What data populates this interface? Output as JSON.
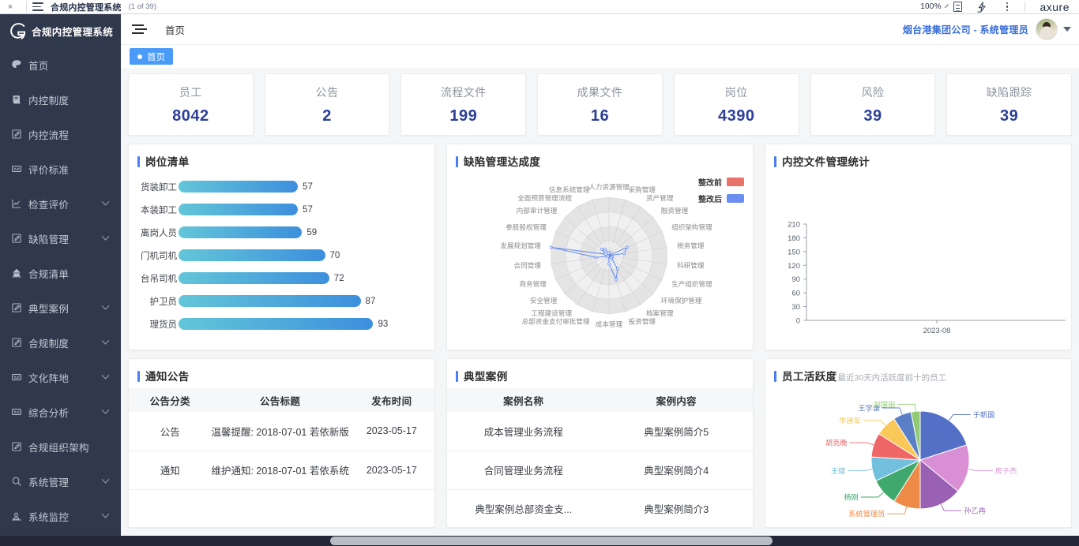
{
  "axure_bar": {
    "close_label": "×",
    "hamburger_icon": "hamburger-icon",
    "title": "合规内控管理系统",
    "page_count": "(1 of 39)",
    "zoom": "100%",
    "notes_icon": "notes-panel-icon",
    "interactions_icon": "interactions-icon",
    "overflow_icon": "more-options-icon",
    "brand": "axure"
  },
  "sidebar": {
    "logo_label": "合规内控管理系统",
    "items": [
      {
        "label": "首页",
        "icon": "palette-icon",
        "expandable": false
      },
      {
        "label": "内控制度",
        "icon": "book-icon",
        "expandable": false
      },
      {
        "label": "内控流程",
        "icon": "edit-square-icon",
        "expandable": false
      },
      {
        "label": "评价标准",
        "icon": "id-card-icon",
        "expandable": false
      },
      {
        "label": "检查评价",
        "icon": "chart-line-icon",
        "expandable": true
      },
      {
        "label": "缺陷管理",
        "icon": "edit-square-icon",
        "expandable": true
      },
      {
        "label": "合规清单",
        "icon": "archive-icon",
        "expandable": false
      },
      {
        "label": "典型案例",
        "icon": "edit-square-icon",
        "expandable": true
      },
      {
        "label": "合规制度",
        "icon": "edit-square-icon",
        "expandable": true
      },
      {
        "label": "文化阵地",
        "icon": "id-card-icon",
        "expandable": true
      },
      {
        "label": "综合分析",
        "icon": "id-card-icon",
        "expandable": true
      },
      {
        "label": "合规组织架构",
        "icon": "edit-square-icon",
        "expandable": false
      },
      {
        "label": "系统管理",
        "icon": "search-icon",
        "expandable": true
      },
      {
        "label": "系统监控",
        "icon": "monitor-user-icon",
        "expandable": true
      }
    ]
  },
  "topbar": {
    "collapse_icon": "collapse-menu-icon",
    "breadcrumb": "首页",
    "user_name": "烟台港集团公司 - 系统管理员",
    "avatar": "user-avatar",
    "caret_icon": "chevron-down-icon"
  },
  "tabbar": {
    "tabs": [
      {
        "label": "首页",
        "active": true
      }
    ]
  },
  "stats": [
    {
      "label": "员工",
      "value": "8042"
    },
    {
      "label": "公告",
      "value": "2"
    },
    {
      "label": "流程文件",
      "value": "199"
    },
    {
      "label": "成果文件",
      "value": "16"
    },
    {
      "label": "岗位",
      "value": "4390"
    },
    {
      "label": "风险",
      "value": "39"
    },
    {
      "label": "缺陷跟踪",
      "value": "39"
    }
  ],
  "panels": {
    "positions": {
      "title": "岗位清单"
    },
    "defects": {
      "title": "缺陷管理达成度"
    },
    "docstats": {
      "title": "内控文件管理统计"
    },
    "notices": {
      "title": "通知公告"
    },
    "cases": {
      "title": "典型案例"
    },
    "activity": {
      "title": "员工活跃度",
      "subtitle": "最近30天内活跃度前十的员工"
    }
  },
  "notices_table": {
    "columns": [
      "公告分类",
      "公告标题",
      "发布时间"
    ],
    "rows": [
      [
        "公告",
        "温馨提醒: 2018-07-01 若依新版...",
        "2023-05-17"
      ],
      [
        "通知",
        "维护通知: 2018-07-01 若依系统...",
        "2023-05-17"
      ]
    ]
  },
  "cases_table": {
    "columns": [
      "案例名称",
      "案例内容"
    ],
    "rows": [
      [
        "成本管理业务流程",
        "典型案例简介5"
      ],
      [
        "合同管理业务流程",
        "典型案例简介4"
      ],
      [
        "典型案例总部资金支...",
        "典型案例简介3"
      ]
    ]
  },
  "colors": {
    "accent": "#4a7ef5",
    "sidebar_bg": "#30394c",
    "stat_value": "#2b3f99",
    "tab_active": "#4a9bf7",
    "bar_start": "#63c6d8",
    "bar_end": "#3d8fdd",
    "radar_before": "#e8736a",
    "radar_after": "#6b8ff0"
  },
  "chart_data": [
    {
      "type": "bar",
      "title": "岗位清单",
      "orientation": "horizontal",
      "categories": [
        "货装卸工",
        "本装卸工",
        "离岗人员",
        "门机司机",
        "台吊司机",
        "护卫员",
        "理货员"
      ],
      "values": [
        57,
        57,
        59,
        70,
        72,
        87,
        93
      ],
      "xlabel": "",
      "ylabel": "",
      "xlim": [
        0,
        100
      ],
      "grid": false,
      "datalabels": [
        "57",
        "57",
        "59",
        "70",
        "72",
        "87",
        "93"
      ]
    },
    {
      "type": "radar",
      "title": "缺陷管理达成度",
      "legend": [
        "整改前",
        "整改后"
      ],
      "legend_position": "top-right",
      "axes": [
        "人力资源管理",
        "采购管理",
        "资产管理",
        "融资管理",
        "组织架构管理",
        "税务管理",
        "科研管理",
        "生产组织管理",
        "环境保护管理",
        "档案管理",
        "投资管理",
        "成本管理",
        "总部资金支付审批管理",
        "工程建设管理",
        "安全管理",
        "商务管理",
        "合同管理",
        "发展规划管理",
        "参股股权管理",
        "内部审计管理",
        "全面预算管理流程",
        "信息系统管理"
      ],
      "series": [
        {
          "name": "整改前",
          "color": "#e8736a",
          "values": [
            0,
            0,
            0,
            0,
            0,
            0,
            0,
            0,
            0,
            0,
            0,
            0,
            0,
            0,
            0,
            0,
            0,
            0,
            0,
            0,
            0,
            0
          ]
        },
        {
          "name": "整改后",
          "color": "#6b8ff0",
          "values": [
            2,
            6,
            1,
            1,
            34,
            26,
            0,
            6,
            5,
            27,
            43,
            14,
            1,
            1,
            1,
            2,
            22,
            100,
            6,
            17,
            13,
            4
          ]
        }
      ],
      "max": 100,
      "rings": 4,
      "grid": true
    },
    {
      "type": "line",
      "title": "内控文件管理统计",
      "x": [
        "2023-08"
      ],
      "series": [
        {
          "name": "",
          "values": [
            0
          ]
        }
      ],
      "ylim": [
        0,
        210
      ],
      "yticks": [
        0,
        30,
        60,
        90,
        120,
        150,
        180,
        210
      ],
      "xlabel": "",
      "ylabel": "",
      "grid": false
    },
    {
      "type": "pie",
      "title": "员工活跃度",
      "subtitle": "最近30天内活跃度前十的员工",
      "labels": [
        "于新国",
        "房子杰",
        "孙乙冉",
        "系统管理员",
        "杨刚",
        "王健",
        "胡克晚",
        "李建军",
        "王学谦",
        "刘国田"
      ],
      "values": [
        20,
        16,
        14,
        9,
        9,
        8,
        8,
        7,
        6,
        3
      ],
      "colors": [
        "#5470c6",
        "#d98fd4",
        "#9a60b4",
        "#ee8b47",
        "#3fa86c",
        "#73c0de",
        "#ee6666",
        "#fac858",
        "#5b7fc7",
        "#91cc75"
      ],
      "legend_position": "labels-outside"
    }
  ]
}
